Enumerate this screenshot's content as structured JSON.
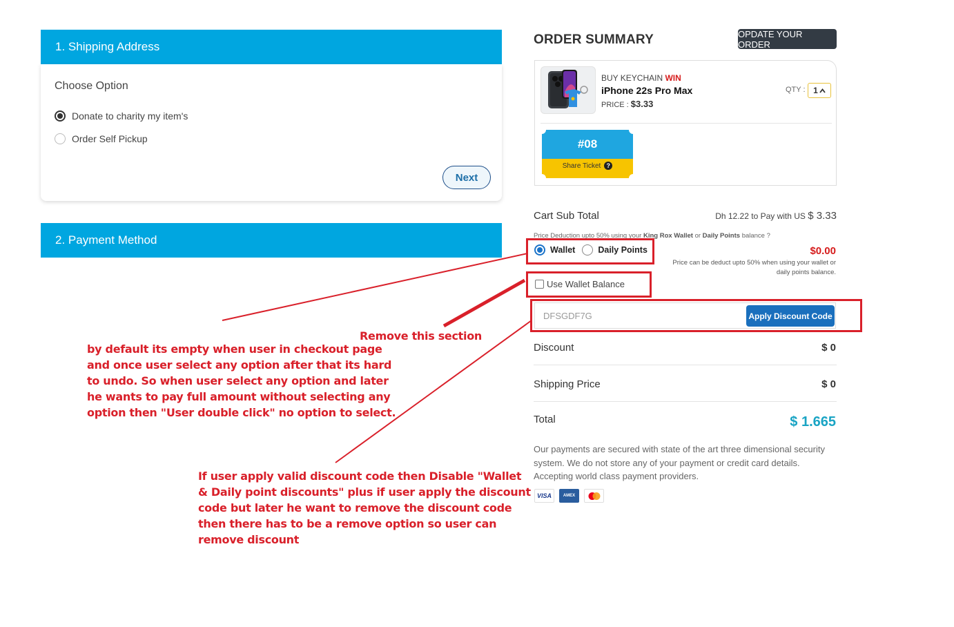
{
  "shipping": {
    "header": "1. Shipping Address",
    "choose_label": "Choose Option",
    "options": [
      "Donate to charity my item's",
      "Order Self Pickup"
    ],
    "selected_option": "Donate to charity my item's",
    "next_label": "Next"
  },
  "payment": {
    "header": "2. Payment Method"
  },
  "summary": {
    "title": "ORDER SUMMARY",
    "update_button": "OPDATE YOUR ORDER",
    "product": {
      "promo_prefix": "BUY KEYCHAIN",
      "promo_win": "WIN",
      "name": "iPhone 22s Pro Max",
      "price_label": "PRICE :",
      "price": "$3.33",
      "qty_label": "QTY :",
      "qty": "1"
    },
    "ticket": {
      "number": "#08",
      "share_label": "Share Ticket"
    },
    "subtotal": {
      "label": "Cart Sub Total",
      "dh": "Dh 12.22 to Pay with US",
      "usd": "$ 3.33"
    },
    "deduction": {
      "note_prefix": "Price Deduction upto 50% using your",
      "wallet_name": "King Rox Wallet",
      "or": "or",
      "points_name": "Daily Points",
      "note_suffix": "balance ?",
      "options": [
        "Wallet",
        "Daily Points"
      ],
      "selected": "Wallet",
      "amount": "$0.00",
      "note": "Price can be deduct upto 50% when using your wallet or daily points balance."
    },
    "use_wallet_label": "Use Wallet Balance",
    "discount_code": {
      "value": "DFSGDF7G",
      "apply_label": "Apply Discount Code"
    },
    "discount": {
      "label": "Discount",
      "value": "$ 0"
    },
    "shipping_price": {
      "label": "Shipping Price",
      "value": "$ 0"
    },
    "total": {
      "label": "Total",
      "value": "$ 1.665"
    },
    "secure_text": "Our payments are secured with state of the art three dimensional security system. We do not store any of your payment or credit card details. Accepting world class payment providers.",
    "cards": [
      "VISA",
      "AMEX",
      "mastercard"
    ]
  },
  "annotations": {
    "remove": "Remove this section",
    "empty_default": [
      "by default its empty when user in checkout page",
      "and once user select any option after that its hard",
      "to undo. So when user select any option and later",
      "he wants to pay full amount without selecting any",
      "option then \"User double click\" no option to select."
    ],
    "discount_note": [
      "If user apply valid discount code then Disable \"Wallet",
      "& Daily point discounts\" plus if user apply the discount",
      "code but later he want to remove the discount code",
      "then there has to be a remove option so user can",
      "remove discount"
    ]
  },
  "colors": {
    "brand_blue": "#00a6e0",
    "annotation_red": "#d9202a",
    "total_teal": "#19a4c4",
    "apply_blue": "#1a6fbd"
  }
}
